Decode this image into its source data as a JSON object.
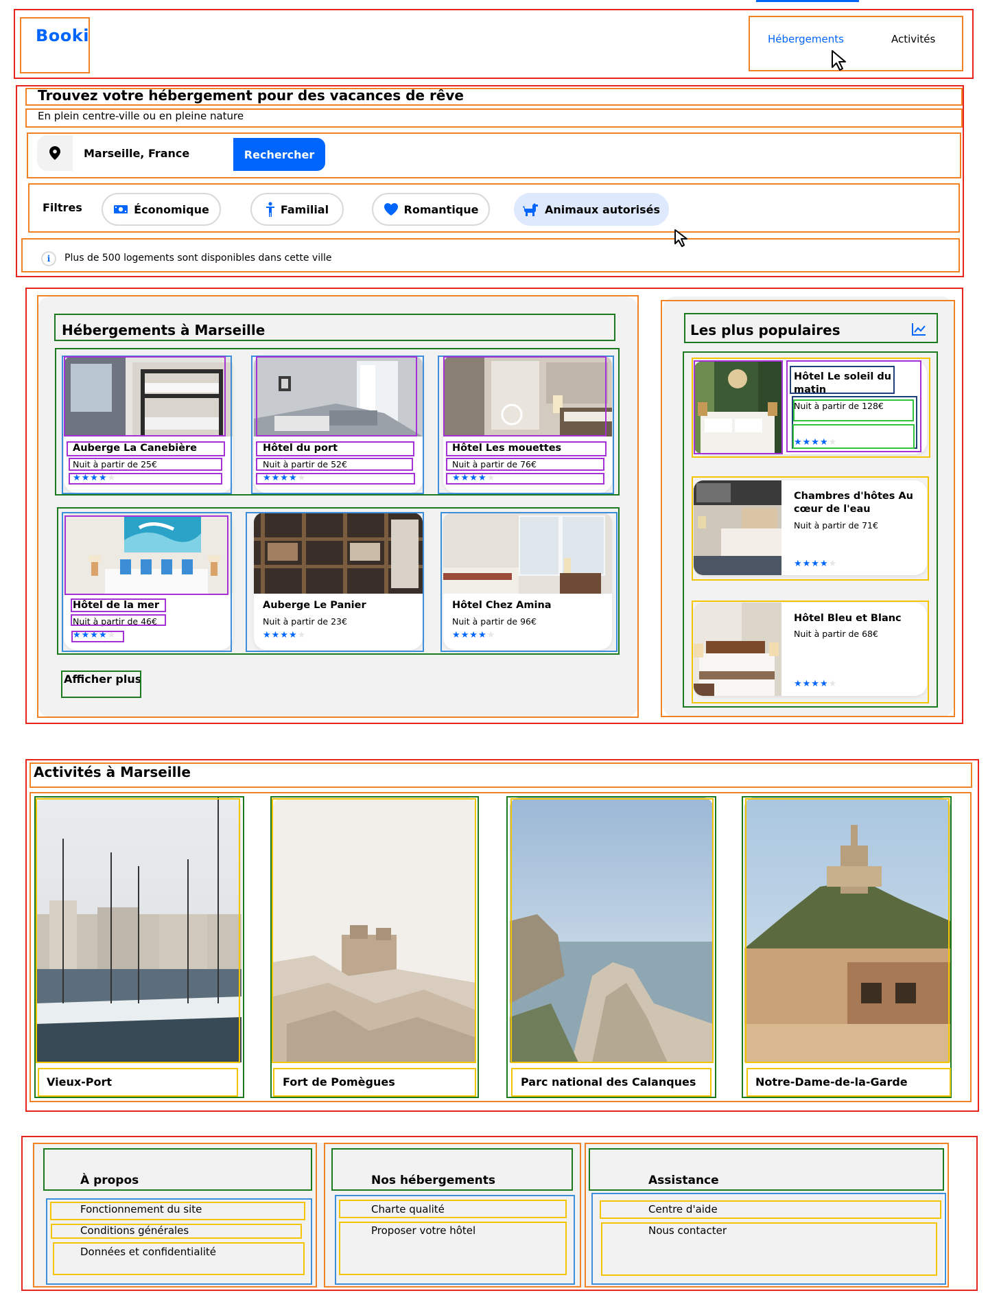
{
  "header": {
    "logo": "Booki",
    "nav": [
      {
        "label": "Hébergements",
        "active": true
      },
      {
        "label": "Activités",
        "active": false
      }
    ]
  },
  "hero": {
    "title": "Trouvez votre hébergement pour des vacances de rêve",
    "subtitle": "En plein centre-ville ou en pleine nature"
  },
  "search": {
    "value": "Marseille, France",
    "button_label": "Rechercher",
    "icon": "location-pin-icon"
  },
  "filters": {
    "label": "Filtres",
    "items": [
      {
        "label": "Économique",
        "icon": "money-icon",
        "selected": false
      },
      {
        "label": "Familial",
        "icon": "person-icon",
        "selected": false
      },
      {
        "label": "Romantique",
        "icon": "heart-icon",
        "selected": false
      },
      {
        "label": "Animaux autorisés",
        "icon": "dog-icon",
        "selected": true
      }
    ]
  },
  "info": {
    "icon": "info-icon",
    "text": "Plus de 500 logements sont disponibles dans cette ville"
  },
  "lodgings": {
    "title": "Hébergements à Marseille",
    "cards": [
      {
        "name": "Auberge La Canebière",
        "price": "Nuit à partir de 25€",
        "rating": 4
      },
      {
        "name": "Hôtel du port",
        "price": "Nuit à partir de 52€",
        "rating": 4
      },
      {
        "name": "Hôtel Les mouettes",
        "price": "Nuit à partir de 76€",
        "rating": 4
      },
      {
        "name": "Hôtel de la mer",
        "price": "Nuit à partir de 46€",
        "rating": 4
      },
      {
        "name": "Auberge Le Panier",
        "price": "Nuit à partir de 23€",
        "rating": 4
      },
      {
        "name": "Hôtel Chez Amina",
        "price": "Nuit à partir de 96€",
        "rating": 4
      }
    ],
    "more_label": "Afficher plus"
  },
  "popular": {
    "title": "Les plus populaires",
    "icon": "trend-chart-icon",
    "cards": [
      {
        "name": "Hôtel Le soleil du matin",
        "price": "Nuit à partir de 128€",
        "rating": 4
      },
      {
        "name": "Chambres d'hôtes Au cœur de l'eau",
        "price": "Nuit à partir de 71€",
        "rating": 4
      },
      {
        "name": "Hôtel Bleu et Blanc",
        "price": "Nuit à partir de 68€",
        "rating": 4
      }
    ]
  },
  "activities": {
    "title": "Activités à Marseille",
    "items": [
      {
        "label": "Vieux-Port"
      },
      {
        "label": "Fort de Pomègues"
      },
      {
        "label": "Parc national des Calanques"
      },
      {
        "label": "Notre-Dame-de-la-Garde"
      }
    ]
  },
  "footer": {
    "columns": [
      {
        "title": "À propos",
        "links": [
          "Fonctionnement du site",
          "Conditions générales",
          "Données et confidentialité"
        ]
      },
      {
        "title": "Nos hébergements",
        "links": [
          "Charte qualité",
          "Proposer votre hôtel"
        ]
      },
      {
        "title": "Assistance",
        "links": [
          "Centre d'aide",
          "Nous contacter"
        ]
      }
    ]
  },
  "colors": {
    "primary": "#0065fc",
    "selected_chip": "#dee9fe",
    "panel": "#f2f2f2",
    "outline_red": "#e8231b",
    "outline_orange": "#f08224",
    "outline_green": "#1a7a1d",
    "outline_blue": "#3a8fd8",
    "outline_purple": "#a531d6",
    "outline_yellow": "#f2c500"
  }
}
